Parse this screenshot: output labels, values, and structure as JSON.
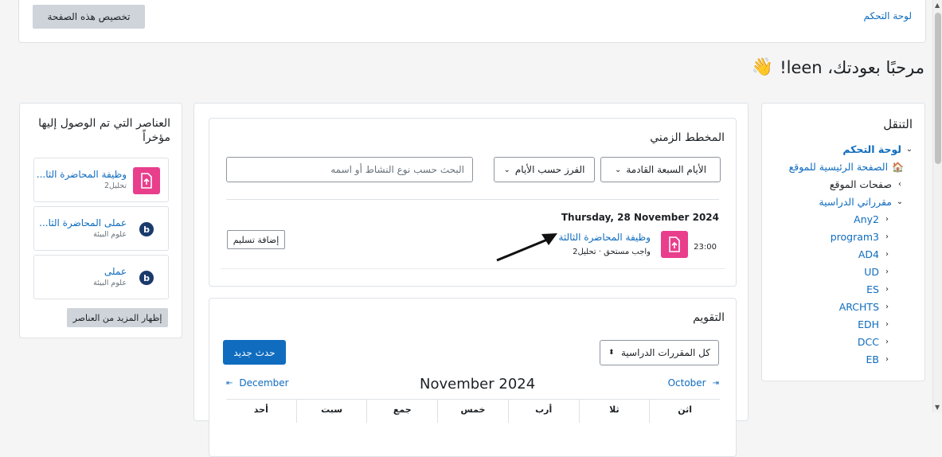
{
  "header": {
    "breadcrumb": "لوحة التحكم",
    "customize_button": "تخصيص هذه الصفحة",
    "greeting": "مرحبًا بعودتك، leen!",
    "wave_emoji": "👋"
  },
  "navigation": {
    "title": "التنقل",
    "items": [
      {
        "label": "لوحة التحكم",
        "level": 0,
        "chevron": "down",
        "bold": true
      },
      {
        "label": "الصفحة الرئيسية للموقع",
        "level": 1,
        "icon": "home-icon"
      },
      {
        "label": "صفحات الموقع",
        "level": 1,
        "chevron": "right"
      },
      {
        "label": "مقرراتي الدراسية",
        "level": 1,
        "chevron": "down"
      },
      {
        "label": "Any2",
        "level": 2,
        "chevron": "left"
      },
      {
        "label": "program3",
        "level": 2,
        "chevron": "left"
      },
      {
        "label": "AD4",
        "level": 2,
        "chevron": "left"
      },
      {
        "label": "UD",
        "level": 2,
        "chevron": "left"
      },
      {
        "label": "ES",
        "level": 2,
        "chevron": "left"
      },
      {
        "label": "ARCHTS",
        "level": 2,
        "chevron": "left"
      },
      {
        "label": "EDH",
        "level": 2,
        "chevron": "left"
      },
      {
        "label": "DCC",
        "level": 2,
        "chevron": "left"
      },
      {
        "label": "EB",
        "level": 2,
        "chevron": "left"
      }
    ]
  },
  "timeline": {
    "title": "المخطط الزمني",
    "range_dropdown": "الأيام السبعة القادمة",
    "sort_dropdown": "الفرز حسب الأيام",
    "search_placeholder": "البحث حسب نوع النشاط أو اسمه",
    "date_heading": "Thursday, 28 November 2024",
    "event": {
      "time": "23:00",
      "title": "وظيفة المحاضرة الثالثة",
      "meta": "واجب مستحق · تحليل2",
      "action": "إضافة تسليم"
    }
  },
  "calendar": {
    "title": "التقويم",
    "course_filter": "كل المقررات الدراسية",
    "new_event_button": "حدث جديد",
    "prev_month": "October",
    "current_month": "November 2024",
    "next_month": "December",
    "weekdays": [
      "اثن",
      "ثلا",
      "أرب",
      "خمس",
      "جمع",
      "سبت",
      "أحد"
    ]
  },
  "recent_items": {
    "title": "العناصر التي تم الوصول إليها مؤخراً",
    "items": [
      {
        "title": "وظيفة المحاضرة الثا...",
        "subtitle": "تحليل2",
        "icon": "assignment-icon"
      },
      {
        "title": "عملى المحاضرة الثا...",
        "subtitle": "علوم البيئة",
        "icon": "bigbluebutton-icon"
      },
      {
        "title": "عملى",
        "subtitle": "علوم البيئة",
        "icon": "bigbluebutton-icon"
      }
    ],
    "show_more_button": "إظهار المزيد من العناصر"
  },
  "colors": {
    "brand": "#0f6cbf",
    "assignment": "#e83e8c"
  }
}
